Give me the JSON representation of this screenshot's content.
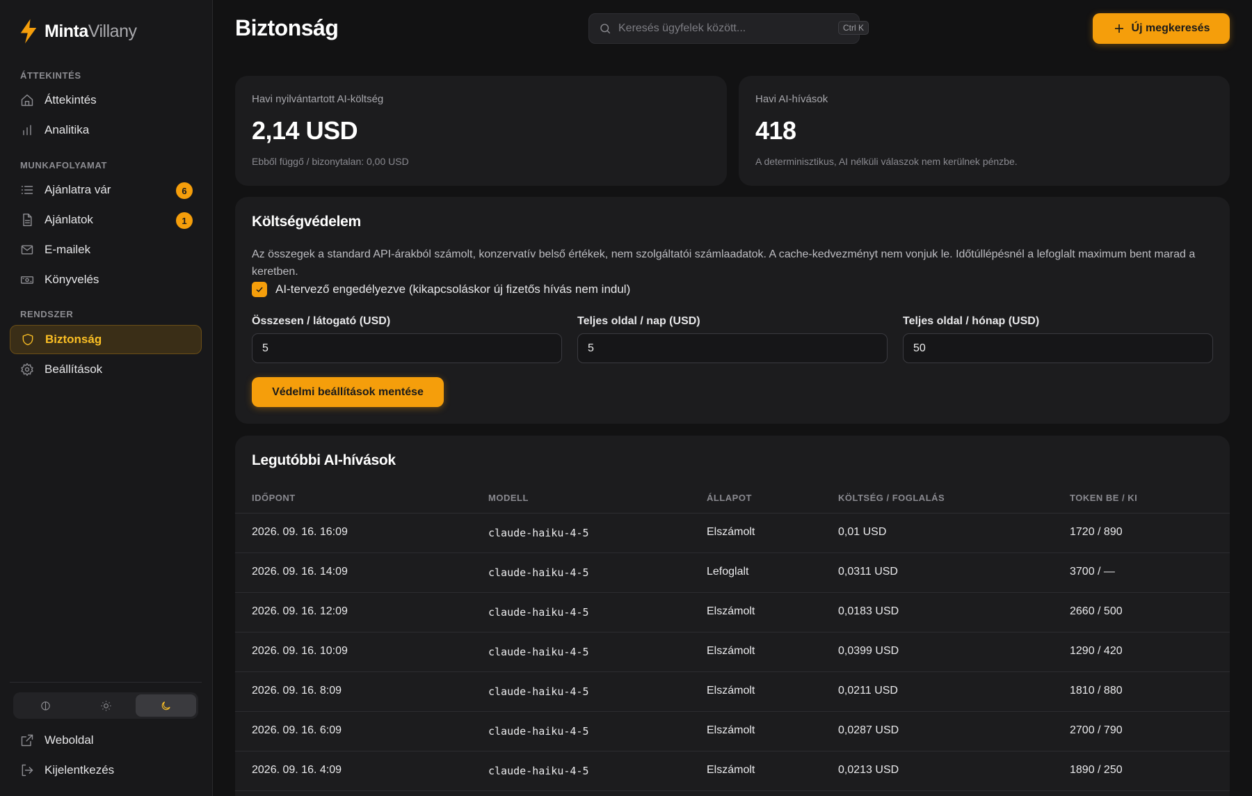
{
  "brand": {
    "name_a": "Minta",
    "name_b": "Villany"
  },
  "sidebar": {
    "sections": [
      {
        "label": "ÁTTEKINTÉS"
      },
      {
        "label": "MUNKAFOLYAMAT"
      },
      {
        "label": "RENDSZER"
      }
    ],
    "items": [
      {
        "label": "Áttekintés",
        "icon": "home-icon"
      },
      {
        "label": "Analitika",
        "icon": "bar-chart-icon"
      },
      {
        "label": "Ajánlatra vár",
        "icon": "list-icon",
        "badge": "6"
      },
      {
        "label": "Ajánlatok",
        "icon": "document-icon",
        "badge": "1"
      },
      {
        "label": "E-mailek",
        "icon": "mail-icon"
      },
      {
        "label": "Könyvelés",
        "icon": "banknote-icon"
      },
      {
        "label": "Biztonság",
        "icon": "shield-icon",
        "active": true
      },
      {
        "label": "Beállítások",
        "icon": "gear-icon"
      }
    ],
    "theme_options": [
      "system-icon",
      "sun-icon",
      "moon-icon"
    ],
    "theme_selected": "moon-icon",
    "footer": [
      {
        "label": "Weboldal",
        "icon": "external-link-icon"
      },
      {
        "label": "Kijelentkezés",
        "icon": "logout-icon"
      }
    ]
  },
  "header": {
    "title": "Biztonság",
    "search_placeholder": "Keresés ügyfelek között...",
    "search_shortcut": "Ctrl K",
    "new_button": "Új megkeresés"
  },
  "stats": [
    {
      "label": "Havi nyilvántartott AI-költség",
      "value": "2,14 USD",
      "sub": "Ebből függő / bizonytalan: 0,00 USD"
    },
    {
      "label": "Havi AI-hívások",
      "value": "418",
      "sub": "A determinisztikus, AI nélküli válaszok nem kerülnek pénzbe."
    }
  ],
  "protection": {
    "title": "Költségvédelem",
    "description": "Az összegek a standard API-árakból számolt, konzervatív belső értékek, nem szolgáltatói számlaadatok. A cache-kedvezményt nem vonjuk le. Időtúllépésnél a lefoglalt maximum bent marad a keretben.",
    "checkbox_label": "AI-tervező engedélyezve (kikapcsoláskor új fizetős hívás nem indul)",
    "checkbox_checked": true,
    "fields": [
      {
        "label": "Összesen / látogató (USD)",
        "value": "5"
      },
      {
        "label": "Teljes oldal / nap (USD)",
        "value": "5"
      },
      {
        "label": "Teljes oldal / hónap (USD)",
        "value": "50"
      }
    ],
    "save_button": "Védelmi beállítások mentése"
  },
  "recent": {
    "title": "Legutóbbi AI-hívások",
    "columns": [
      "IDŐPONT",
      "MODELL",
      "ÁLLAPOT",
      "KÖLTSÉG / FOGLALÁS",
      "TOKEN BE / KI"
    ],
    "rows": [
      [
        "2026. 09. 16. 16:09",
        "claude-haiku-4-5",
        "Elszámolt",
        "0,01 USD",
        "1720 / 890"
      ],
      [
        "2026. 09. 16. 14:09",
        "claude-haiku-4-5",
        "Lefoglalt",
        "0,0311 USD",
        "3700 / —"
      ],
      [
        "2026. 09. 16. 12:09",
        "claude-haiku-4-5",
        "Elszámolt",
        "0,0183 USD",
        "2660 / 500"
      ],
      [
        "2026. 09. 16. 10:09",
        "claude-haiku-4-5",
        "Elszámolt",
        "0,0399 USD",
        "1290 / 420"
      ],
      [
        "2026. 09. 16. 8:09",
        "claude-haiku-4-5",
        "Elszámolt",
        "0,0211 USD",
        "1810 / 880"
      ],
      [
        "2026. 09. 16. 6:09",
        "claude-haiku-4-5",
        "Elszámolt",
        "0,0287 USD",
        "2700 / 790"
      ],
      [
        "2026. 09. 16. 4:09",
        "claude-haiku-4-5",
        "Elszámolt",
        "0,0213 USD",
        "1890 / 250"
      ]
    ]
  },
  "colors": {
    "accent": "#f59e0b",
    "background": "#121213",
    "card": "#1c1c1e"
  }
}
